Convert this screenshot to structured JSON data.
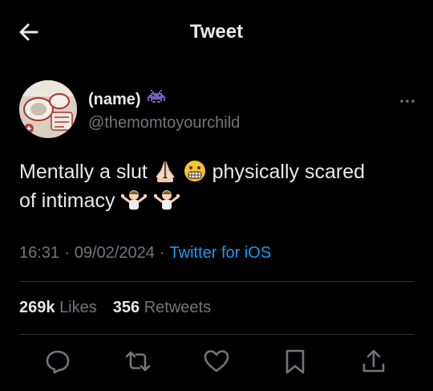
{
  "header": {
    "title": "Tweet",
    "back_icon": "back-arrow-icon"
  },
  "author": {
    "name": "(name)",
    "badge_icon": "alien-monster-emoji-icon",
    "handle": "@themomtoyourchild",
    "more_icon": "more-dots-icon"
  },
  "tweet": {
    "text_part1": "Mentally a slut",
    "emoji1": "folded-hands-emoji-icon",
    "emoji2": "grimacing-face-emoji-icon",
    "text_part2": "physically scared",
    "text_part3": "of intimacy",
    "emoji3": "man-shrugging-emoji-icon"
  },
  "meta": {
    "time": "16:31",
    "sep1": "·",
    "date": "09/02/2024",
    "sep2": "·",
    "source": "Twitter for iOS"
  },
  "stats": {
    "likes_count": "269k",
    "likes_label": "Likes",
    "retweets_count": "356",
    "retweets_label": "Retweets"
  },
  "actions": [
    "reply-icon",
    "retweet-icon",
    "like-icon",
    "bookmark-icon",
    "share-icon"
  ],
  "colors": {
    "background": "#000000",
    "text": "#e7e9ea",
    "muted": "#71767b",
    "accent": "#1d9bf0",
    "divider": "#2f3336"
  }
}
